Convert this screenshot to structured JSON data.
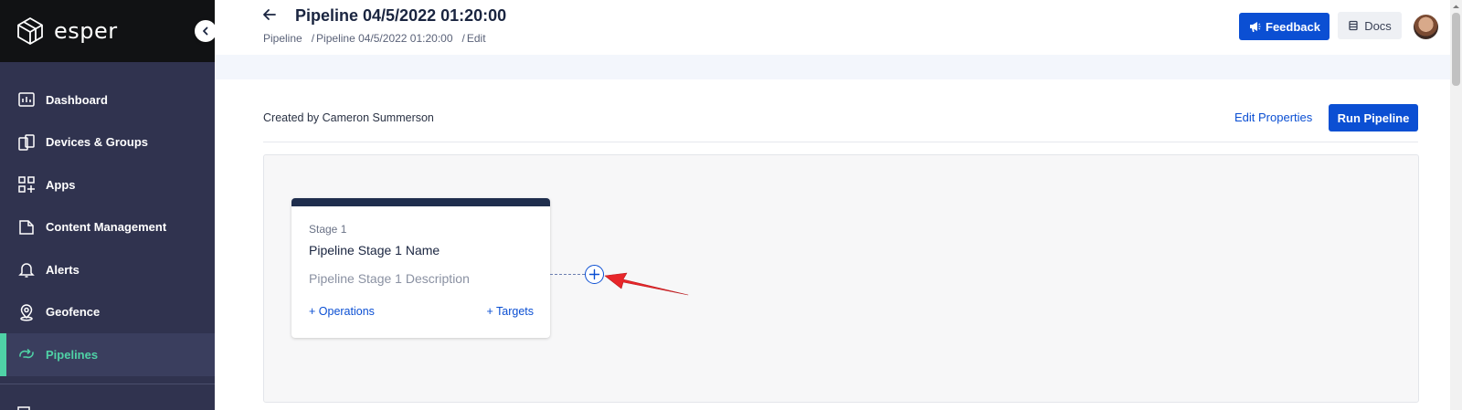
{
  "sidebar": {
    "brand": "esper",
    "items": [
      {
        "label": "Dashboard",
        "icon": "dashboard-icon"
      },
      {
        "label": "Devices & Groups",
        "icon": "devices-icon"
      },
      {
        "label": "Apps",
        "icon": "apps-icon"
      },
      {
        "label": "Content Management",
        "icon": "folder-icon"
      },
      {
        "label": "Alerts",
        "icon": "bell-icon"
      },
      {
        "label": "Geofence",
        "icon": "location-pin-icon"
      },
      {
        "label": "Pipelines",
        "icon": "pipelines-icon",
        "active": true
      }
    ]
  },
  "header": {
    "title": "Pipeline 04/5/2022 01:20:00",
    "breadcrumb": [
      "Pipeline",
      "Pipeline 04/5/2022 01:20:00",
      "Edit"
    ],
    "feedback_label": "Feedback",
    "docs_label": "Docs"
  },
  "content": {
    "created_by": "Created by Cameron Summerson",
    "edit_properties_label": "Edit Properties",
    "run_pipeline_label": "Run Pipeline"
  },
  "stage": {
    "label": "Stage 1",
    "name": "Pipeline Stage 1 Name",
    "description": "Pipeline Stage 1 Description",
    "operations_label": "+ Operations",
    "targets_label": "+ Targets"
  },
  "colors": {
    "primary": "#0b4fd3",
    "sidebar_bg": "#30334f",
    "active_accent": "#4fd2a6",
    "annotation": "#e8262a"
  }
}
